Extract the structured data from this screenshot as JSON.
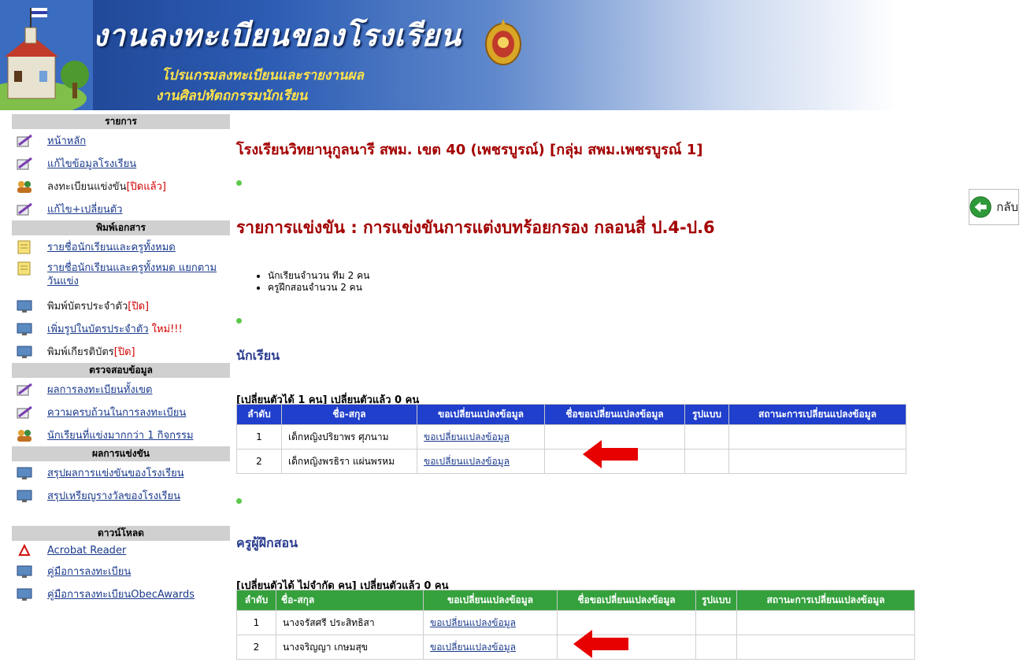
{
  "banner": {
    "title": "งานลงทะเบียนของโรงเรียน",
    "subtitle1": "โปรแกรมลงทะเบียนและรายงานผล",
    "subtitle2": "งานศิลปหัตถกรรมนักเรียน"
  },
  "sidebar": {
    "sections": [
      {
        "heading": "รายการ",
        "items": [
          {
            "label": "หน้าหลัก",
            "icon": "pencil-icon",
            "link": true
          },
          {
            "label": "แก้ไขข้อมูลโรงเรียน",
            "icon": "pencil-icon",
            "link": true
          },
          {
            "label": "ลงทะเบียนแข่งขัน",
            "tag": "[ปิดแล้ว]",
            "icon": "people-icon",
            "link": false
          },
          {
            "label": "แก้ไข+เปลี่ยนตัว",
            "icon": "pencil-icon",
            "link": true
          }
        ]
      },
      {
        "heading": "พิมพ์เอกสาร",
        "items": [
          {
            "label": "รายชื่อนักเรียนและครูทั้งหมด",
            "icon": "note-icon",
            "link": true
          },
          {
            "label": "รายชื่อนักเรียนและครูทั้งหมด แยกตามวันแข่ง",
            "icon": "note-icon",
            "link": true
          },
          {
            "label": "พิมพ์บัตรประจำตัว",
            "tag": "[ปิด]",
            "icon": "computer-icon",
            "link": false
          },
          {
            "label": "เพิ่มรูปในบัตรประจำตัว",
            "tag": "ใหม่!!!",
            "icon": "computer-icon",
            "link": true
          },
          {
            "label": "พิมพ์เกียรติบัตร",
            "tag": "[ปิด]",
            "icon": "computer-icon",
            "link": false
          }
        ]
      },
      {
        "heading": "ตรวจสอบข้อมูล",
        "items": [
          {
            "label": "ผลการลงทะเบียนทั้งเขต",
            "icon": "pencil-icon",
            "link": true
          },
          {
            "label": "ความครบถ้วนในการลงทะเบียน",
            "icon": "pencil-icon",
            "link": true
          },
          {
            "label": "นักเรียนที่แข่งมากกว่า 1 กิจกรรม",
            "icon": "people-icon",
            "link": true
          }
        ]
      },
      {
        "heading": "ผลการแข่งขัน",
        "items": [
          {
            "label": "สรุปผลการแข่งขันของโรงเรียน",
            "icon": "computer-icon",
            "link": true
          },
          {
            "label": "สรุปเหรียญรางวัลของโรงเรียน",
            "icon": "computer-icon",
            "link": true
          }
        ]
      },
      {
        "heading": "ดาวน์โหลด",
        "items": [
          {
            "label": "Acrobat Reader",
            "icon": "pdf-icon",
            "link": true
          },
          {
            "label": "คู่มือการลงทะเบียน",
            "icon": "computer-icon",
            "link": true
          },
          {
            "label": "คู่มือการลงทะเบียนObecAwards",
            "icon": "computer-icon",
            "link": true
          }
        ]
      }
    ]
  },
  "main": {
    "school": "โรงเรียนวิทยานุกูลนารี สพม. เขต 40 (เพชรบูรณ์) [กลุ่ม สพม.เพชรบูรณ์ 1]",
    "contest": "รายการแข่งขัน : การแข่งขันการแต่งบทร้อยกรอง กลอนสี่ ป.4-ป.6",
    "bullets": [
      "นักเรียนจำนวน ทีม 2 คน",
      "ครูฝึกสอนจำนวน 2 คน"
    ],
    "back_label": "กลับ",
    "students": {
      "title": "นักเรียน",
      "quota": "[เปลี่ยนตัวได้ 1 คน] เปลี่ยนตัวแล้ว 0 คน",
      "headers": [
        "ลำดับ",
        "ชื่อ-สกุล",
        "ขอเปลี่ยนแปลงข้อมูล",
        "ชื่อขอเปลี่ยนแปลงข้อมูล",
        "รูปแบบ",
        "สถานะการเปลี่ยนแปลงข้อมูล"
      ],
      "rows": [
        {
          "no": "1",
          "name": "เด็กหญิงปริยาพร ศุภนาม",
          "action": "ขอเปลี่ยนแปลงข้อมูล"
        },
        {
          "no": "2",
          "name": "เด็กหญิงพรธิรา แผ่นพรหม",
          "action": "ขอเปลี่ยนแปลงข้อมูล"
        }
      ]
    },
    "teachers": {
      "title": "ครูผู้ฝึกสอน",
      "quota": "[เปลี่ยนตัวได้ ไม่จำกัด คน] เปลี่ยนตัวแล้ว 0 คน",
      "headers": [
        "ลำดับ",
        "ชื่อ-สกุล",
        "ขอเปลี่ยนแปลงข้อมูล",
        "ชื่อขอเปลี่ยนแปลงข้อมูล",
        "รูปแบบ",
        "สถานะการเปลี่ยนแปลงข้อมูล"
      ],
      "rows": [
        {
          "no": "1",
          "name": "นางจรัสศรี ประสิทธิสา",
          "action": "ขอเปลี่ยนแปลงข้อมูล"
        },
        {
          "no": "2",
          "name": "นางจริญญา เกษมสุข",
          "action": "ขอเปลี่ยนแปลงข้อมูล"
        }
      ]
    }
  },
  "colors": {
    "accent_red": "#a30000",
    "student_header": "#1f3fcc",
    "teacher_header": "#34a13c",
    "arrow": "#e60000"
  }
}
